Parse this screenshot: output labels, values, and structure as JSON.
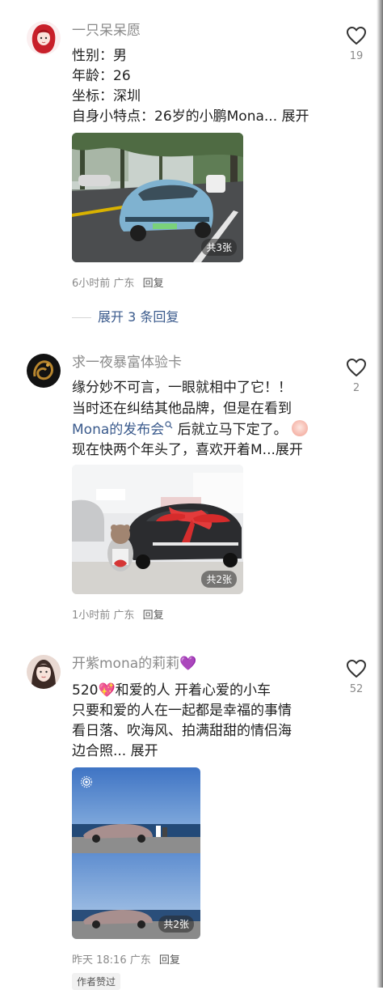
{
  "comments": [
    {
      "username": "一只呆呆愿",
      "lines": [
        "性别：男",
        "年龄：26",
        "坐标：深圳"
      ],
      "last_line": "自身小特点：26岁的小鹏Mona...",
      "expand": "展开",
      "like_count": "19",
      "photo_badge": "共3张",
      "time": "6小时前",
      "location": "广东",
      "reply": "回复",
      "more_replies": "展开 3 条回复"
    },
    {
      "username": "求一夜暴富体验卡",
      "line1": "缘分妙不可言，一眼就相中了它！！",
      "line2": "当时还在纠结其他品牌，但是在看到",
      "line3_link": "Mona的发布会",
      "line3_rest": " 后就立马下定了。",
      "line4": "现在快两个年头了，喜欢开着M...",
      "expand": "展开",
      "like_count": "2",
      "photo_badge": "共2张",
      "time": "1小时前",
      "location": "广东",
      "reply": "回复"
    },
    {
      "username": "开紫mona的莉莉",
      "username_emoji": "💜",
      "line1_pre": "520",
      "line1_emoji": "💖",
      "line1_post": "和爱的人 开着心爱的小车",
      "line2": "只要和爱的人在一起都是幸福的事情",
      "line3": "看日落、吹海风、拍满甜甜的情侣海",
      "line4": "边合照...",
      "expand": "展开",
      "like_count": "52",
      "photo_badge": "共2张",
      "time": "昨天 18:16",
      "location": "广东",
      "reply": "回复",
      "author_tag": "作者赞过"
    }
  ],
  "icons": {
    "like": "heart-outline-icon",
    "search_link": "search-icon",
    "live": "live-photo-icon"
  },
  "colors": {
    "link": "#3a5a8c",
    "muted": "#8a8a8a",
    "text": "#1f1f1f"
  }
}
